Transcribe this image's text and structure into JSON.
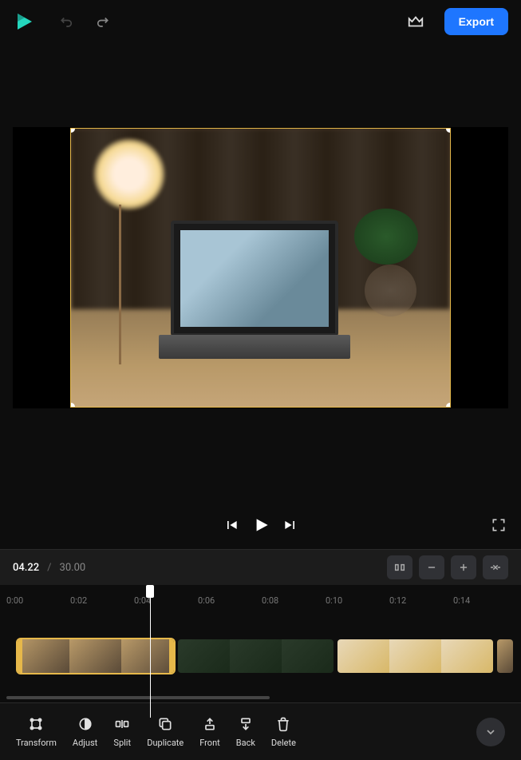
{
  "header": {
    "export_label": "Export"
  },
  "playback": {
    "current_time": "04.22",
    "separator": "/",
    "total_time": "30.00"
  },
  "ruler": {
    "ticks": [
      "0:00",
      "0:02",
      "0:04",
      "0:06",
      "0:08",
      "0:10",
      "0:12",
      "0:14"
    ]
  },
  "tools": {
    "transform": "Transform",
    "adjust": "Adjust",
    "split": "Split",
    "duplicate": "Duplicate",
    "front": "Front",
    "back": "Back",
    "delete": "Delete"
  }
}
